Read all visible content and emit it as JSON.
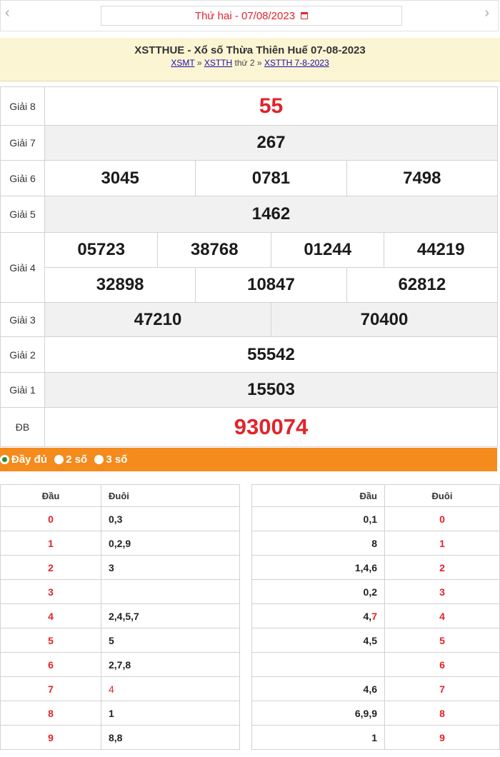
{
  "date_bar": {
    "prev": "‹",
    "next": "›",
    "date_text": "Thứ hai -  07/08/2023"
  },
  "header": {
    "title": "XSTTHUE - Xổ số Thừa Thiên Huế 07-08-2023",
    "crumb1": "XSMT",
    "sep1": "»",
    "crumb2": "XSTTH",
    "mid": "thứ 2",
    "sep2": "»",
    "crumb3": "XSTTH 7-8-2023"
  },
  "prizes": {
    "g8": {
      "label": "Giải 8",
      "values": [
        "55"
      ]
    },
    "g7": {
      "label": "Giải 7",
      "values": [
        "267"
      ]
    },
    "g6": {
      "label": "Giải 6",
      "values": [
        "3045",
        "0781",
        "7498"
      ]
    },
    "g5": {
      "label": "Giải 5",
      "values": [
        "1462"
      ]
    },
    "g4": {
      "label": "Giải 4",
      "values": [
        "05723",
        "38768",
        "01244",
        "44219",
        "32898",
        "10847",
        "62812"
      ]
    },
    "g3": {
      "label": "Giải 3",
      "values": [
        "47210",
        "70400"
      ]
    },
    "g2": {
      "label": "Giải 2",
      "values": [
        "55542"
      ]
    },
    "g1": {
      "label": "Giải 1",
      "values": [
        "15503"
      ]
    },
    "db": {
      "label": "ĐB",
      "values": [
        "930074"
      ]
    }
  },
  "options": {
    "full": "Đầy đủ",
    "two": "2 số",
    "three": "3 số"
  },
  "loto_left": {
    "headers": [
      "Đầu",
      "Đuôi"
    ],
    "rows": [
      {
        "head": "0",
        "tail": "0,3"
      },
      {
        "head": "1",
        "tail": "0,2,9"
      },
      {
        "head": "2",
        "tail": "3"
      },
      {
        "head": "3",
        "tail": ""
      },
      {
        "head": "4",
        "tail": "2,4,5,7"
      },
      {
        "head": "5",
        "tail": "5"
      },
      {
        "head": "6",
        "tail": "2,7,8"
      },
      {
        "head": "7",
        "tail": "4"
      },
      {
        "head": "8",
        "tail": "1"
      },
      {
        "head": "9",
        "tail": "8,8"
      }
    ]
  },
  "loto_right": {
    "headers": [
      "Đầu",
      "Đuôi"
    ],
    "rows": [
      {
        "head": "0,1",
        "tail": "0"
      },
      {
        "head": "8",
        "tail": "1"
      },
      {
        "head": "1,4,6",
        "tail": "2"
      },
      {
        "head": "0,2",
        "tail": "3"
      },
      {
        "head": "4,7",
        "tail": "4"
      },
      {
        "head": "4,5",
        "tail": "5"
      },
      {
        "head": "",
        "tail": "6"
      },
      {
        "head": "4,6",
        "tail": "7"
      },
      {
        "head": "6,9,9",
        "tail": "8"
      },
      {
        "head": "1",
        "tail": "9"
      }
    ]
  }
}
